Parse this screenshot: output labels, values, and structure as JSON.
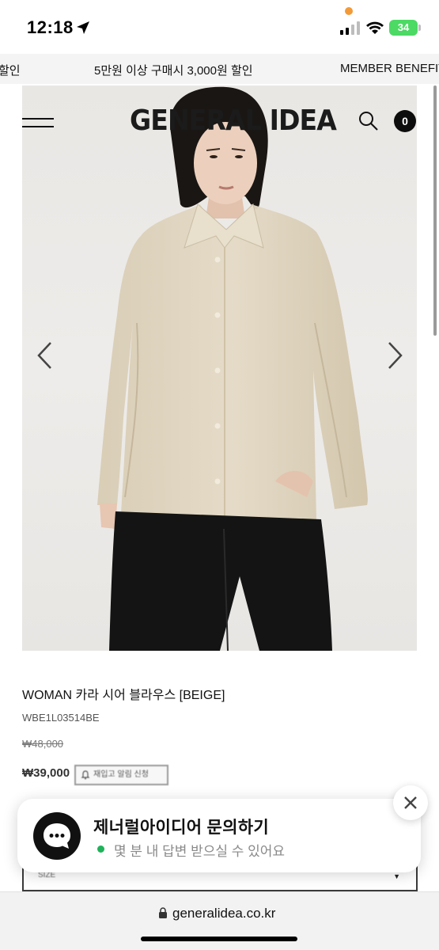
{
  "status_bar": {
    "time": "12:18",
    "battery": "34"
  },
  "promo_marquee": {
    "item_prev_partial": "할인",
    "item_main": "5만원 이상 구매시 3,000원 할인",
    "item_next": "MEMBER BENEFIT"
  },
  "header": {
    "logo": "GENERAL IDEA",
    "cart_count": "0",
    "icons": [
      "hamburger-menu-icon",
      "search-icon",
      "cart-badge"
    ]
  },
  "carousel": {
    "icons": [
      "chevron-left-icon",
      "chevron-right-icon"
    ]
  },
  "product": {
    "name": "WOMAN 카라 시어 블라우스 [BEIGE]",
    "code": "WBE1L03514BE",
    "original_price": "₩48,000",
    "sale_price": "₩39,000",
    "restock_button": "재입고 알림 신청",
    "select_placeholder": "SIZE"
  },
  "chat_banner": {
    "title": "제너럴아이디어 문의하기",
    "subtitle": "몇 분 내 답변 받으실 수 있어요",
    "status_color": "#20b25b"
  },
  "browser": {
    "url": "generalidea.co.kr"
  },
  "colors": {
    "shirt": "#ded3bd",
    "pants": "#141414",
    "background": "#ffffff"
  }
}
